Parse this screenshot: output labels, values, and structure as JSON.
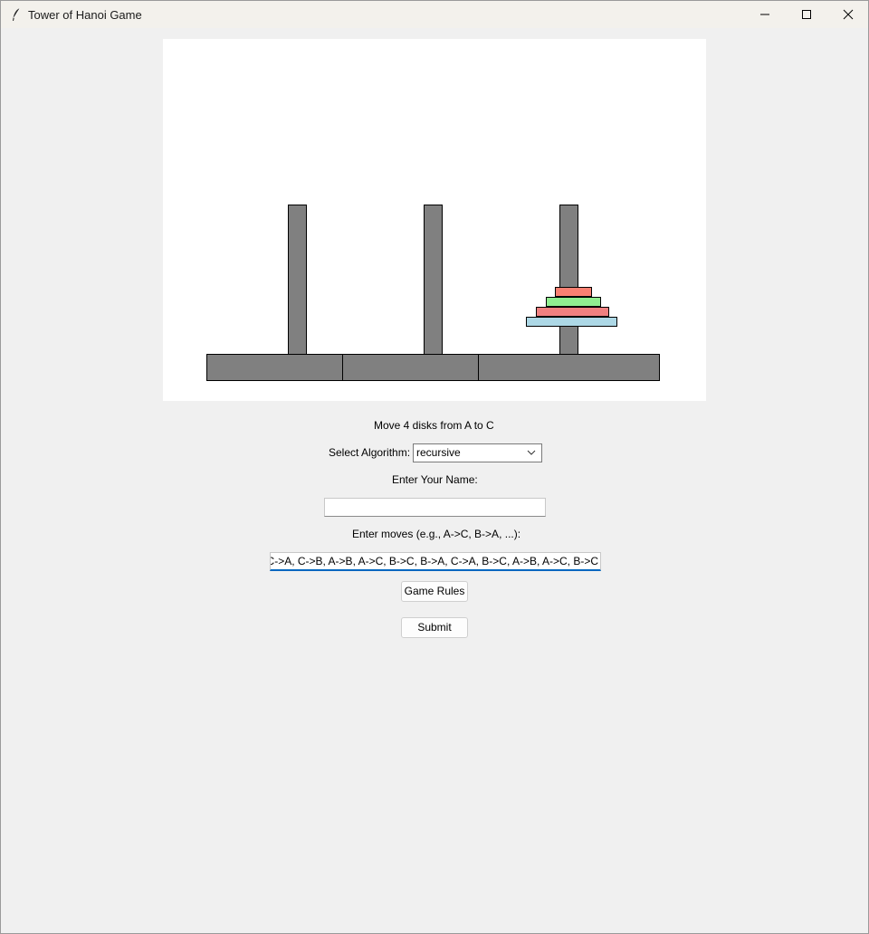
{
  "window": {
    "title": "Tower of Hanoi Game"
  },
  "colors": {
    "peg": "#808080",
    "disk_1": "#fa8072",
    "disk_2": "#90ee90",
    "disk_3": "#f08080",
    "disk_4": "#add8e6"
  },
  "game": {
    "pegs": [
      "A",
      "B",
      "C"
    ],
    "disks_on_peg_c": 4,
    "instruction": "Move 4 disks from A to C"
  },
  "form": {
    "algorithm_label": "Select Algorithm:",
    "algorithm_value": "recursive",
    "name_label": "Enter Your Name:",
    "name_value": "",
    "moves_label": "Enter moves (e.g., A->C, B->A, ...):",
    "moves_value": "A->B, A->C, B->C, A->B, C->A, C->B, A->B, A->C, B->C, B->A, C->A, B->C, A->B, A->C, B->C"
  },
  "buttons": {
    "rules_label": "Game Rules",
    "submit_label": "Submit"
  }
}
